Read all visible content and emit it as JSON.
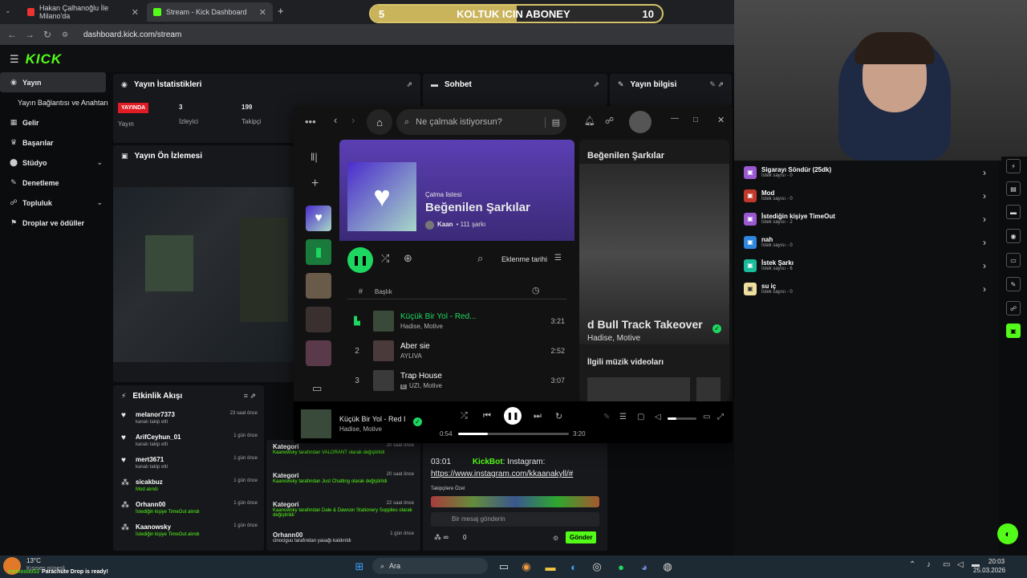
{
  "browser": {
    "tabs": [
      {
        "title": "Hakan Çalhanoğlu İle Milano'da"
      },
      {
        "title": "Stream - Kick Dashboard"
      }
    ],
    "new_tab": "+",
    "url": "dashboard.kick.com/stream"
  },
  "overlay": {
    "left_num": "5",
    "title": "KOLTUK ICIN ABONEY",
    "right_num": "10",
    "progress": 0.5
  },
  "kick": {
    "logo": "KICK",
    "sidebar": [
      {
        "label": "Yayın",
        "active": true
      },
      {
        "label": "Yayın Bağlantısı ve Anahtarı"
      },
      {
        "label": "Gelir"
      },
      {
        "label": "Başarılar"
      },
      {
        "label": "Stüdyo"
      },
      {
        "label": "Denetleme"
      },
      {
        "label": "Topluluk"
      },
      {
        "label": "Droplar ve ödüller"
      }
    ],
    "stats": {
      "title": "Yayın İstatistikleri",
      "live_badge": "YAYINDA",
      "live_label": "Yayın",
      "viewers_value": "3",
      "viewers_label": "İzleyici",
      "followers_value": "199",
      "followers_label": "Takipçi"
    },
    "chat_title": "Sohbet",
    "info_title": "Yayın bilgisi",
    "preview_title": "Yayın Ön İzlemesi",
    "activity": {
      "title": "Etkinlik Akışı",
      "items": [
        {
          "name": "melanor7373",
          "sub": "kanalı takip etti",
          "time": "23 saat önce",
          "green": false
        },
        {
          "name": "ArifCeyhun_01",
          "sub": "kanalı takip etti",
          "time": "1 gün önce",
          "green": false
        },
        {
          "name": "mert3671",
          "sub": "kanalı takip etti",
          "time": "1 gün önce",
          "green": false
        },
        {
          "name": "sicakbuz",
          "sub": "Mod alındı",
          "time": "1 gün önce",
          "green": true
        },
        {
          "name": "Orhann00",
          "sub": "İstediğin kişiye TimeOut alındı",
          "time": "1 gün önce",
          "green": true
        },
        {
          "name": "Kaanowsky",
          "sub": "İstediğin kişiye TimeOut alındı",
          "time": "1 gün önce",
          "green": true
        }
      ]
    },
    "mod_log": [
      {
        "title": "Kategori",
        "text": "Kaanowsky tarafından VALORANT olarak değiştirildi",
        "time": "20 saat önce"
      },
      {
        "title": "Kategori",
        "text": "Kaanowsky tarafından Just Chatting olarak değiştirildi",
        "time": "20 saat önce"
      },
      {
        "title": "Kategori",
        "text": "Kaanowsky tarafından Dale & Dawson Stationery Supplies olarak değiştirildi",
        "time": "22 saat önce"
      },
      {
        "title": "Orhann00",
        "text": "cinociguu tarafından yasağı kaldırıldı",
        "time": "1 gün önce"
      }
    ],
    "chat": {
      "time": "03:01",
      "user": "KickBot",
      "text": "Instagram:",
      "link": "https://www.instagram.com/kkaanakyll/#",
      "followers_only": "Takipçilere Özel",
      "placeholder": "Bir mesaj gönderin",
      "count": "0",
      "send": "Gönder"
    }
  },
  "spotify": {
    "search_placeholder": "Ne çalmak istiyorsun?",
    "playlist_type": "Çalma listesi",
    "playlist_title": "Beğenilen Şarkılar",
    "owner": "Kaan",
    "song_count": "• 111 şarkı",
    "sort_label": "Eklenme tarihi",
    "col_hash": "#",
    "col_title": "Başlık",
    "tracks": [
      {
        "n": "",
        "title": "Küçük Bir Yol - Red...",
        "artist": "Hadise, Motive",
        "dur": "3:21",
        "playing": true
      },
      {
        "n": "2",
        "title": "Aber sie",
        "artist": "AYLIVA",
        "dur": "2:52",
        "playing": false
      },
      {
        "n": "3",
        "title": "Trap House",
        "artist": "UZI, Motive",
        "dur": "3:07",
        "playing": false,
        "explicit": "E"
      }
    ],
    "right_title": "Beğenilen Şarkılar",
    "right_song": "d Bull Track Takeover",
    "right_artist": "Hadise, Motive",
    "right_section": "İlgili müzik videoları",
    "now_playing_title": "Küçük Bir Yol - Red I",
    "now_playing_artist": "Hadise, Motive",
    "elapsed": "0:54",
    "total": "3:20",
    "progress": 0.27,
    "volume": 0.3
  },
  "rewards": [
    {
      "title": "Sigarayı Söndür (25dk)",
      "sub": "İstek sayısı - 0",
      "color": "#9b59d0"
    },
    {
      "title": "Mod",
      "sub": "İstek sayısı - 0",
      "color": "#c0392b"
    },
    {
      "title": "İstediğin kişiye TimeOut",
      "sub": "İstek sayısı - 2",
      "color": "#9b59d0"
    },
    {
      "title": "nah",
      "sub": "İstek sayısı - 0",
      "color": "#2e86de"
    },
    {
      "title": "İstek Şarkı",
      "sub": "İstek sayısı - 6",
      "color": "#1abc9c"
    },
    {
      "title": "su iç",
      "sub": "İstek sayısı - 0",
      "color": "#f0e0a0"
    }
  ],
  "taskbar": {
    "weather_temp": "13°C",
    "weather_sub": "Kısmen güneşli",
    "notification": "Parachute Drop is ready!",
    "notification_user": "memoooo53",
    "search": "Ara",
    "time": "20:03",
    "date": "25.03.2026"
  }
}
